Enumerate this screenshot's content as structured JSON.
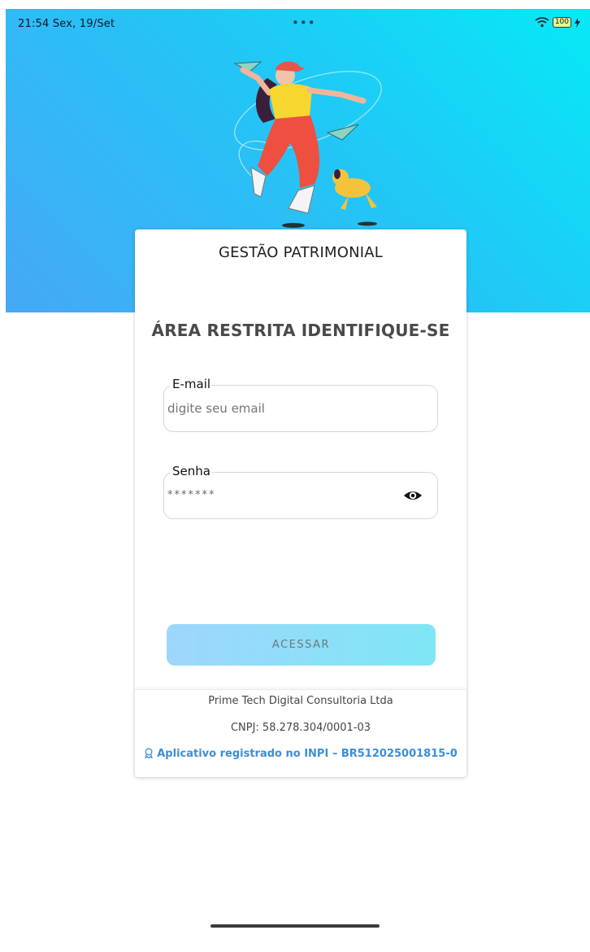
{
  "status_bar": {
    "time": "21:54",
    "date": "Sex, 19/Set",
    "center_dots": "•••",
    "battery_level": "100",
    "wifi_icon": "wifi-icon",
    "charging_icon": "charging-bolt-icon"
  },
  "header": {
    "illustration": "dancing-person-with-paper-planes-and-dog",
    "gradient_colors": [
      "#06e9f7",
      "#46a8f6"
    ]
  },
  "card": {
    "title": "GESTÃO PATRIMONIAL",
    "heading": "ÁREA RESTRITA IDENTIFIQUE-SE"
  },
  "form": {
    "email": {
      "label": "E-mail",
      "placeholder": "digite seu email",
      "value": ""
    },
    "password": {
      "label": "Senha",
      "value": "*******",
      "toggle_icon": "eye-icon"
    },
    "submit_label": "ACESSAR"
  },
  "footer": {
    "company": "Prime Tech Digital Consultoria Ltda",
    "cnpj": "CNPJ: 58.278.304/0001-03",
    "inpi_icon": "award-ribbon-icon",
    "inpi": "Aplicativo registrado no INPI – BR512025001815-0"
  },
  "colors": {
    "accent_link": "#3b8ed6",
    "button_gradient": [
      "#9ed6fb",
      "#7fe6f6"
    ]
  }
}
